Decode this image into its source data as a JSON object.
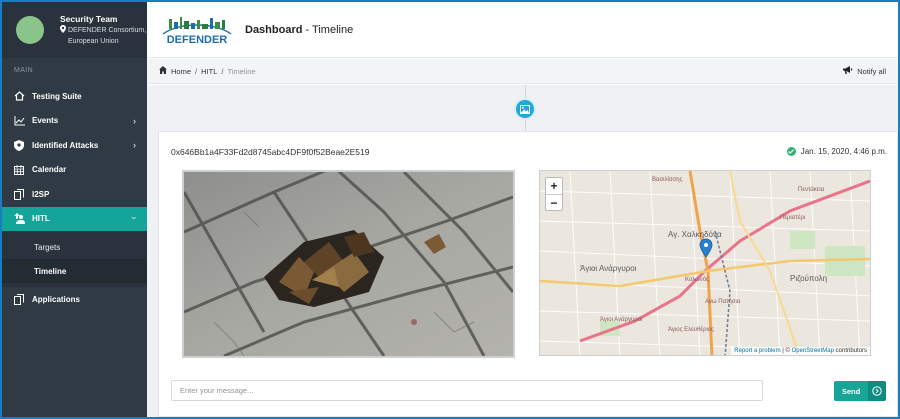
{
  "profile": {
    "name": "Security Team",
    "org_line1": "DEFENDER Consortium,",
    "org_line2": "European Union"
  },
  "sidebar": {
    "section_label": "MAIN",
    "items": [
      {
        "label": "Testing Suite",
        "icon": "home-outline-icon"
      },
      {
        "label": "Events",
        "icon": "chart-line-icon"
      },
      {
        "label": "Identified Attacks",
        "icon": "shield-icon"
      },
      {
        "label": "Calendar",
        "icon": "calendar-icon"
      },
      {
        "label": "I2SP",
        "icon": "copy-icon"
      },
      {
        "label": "HITL",
        "icon": "user-upload-icon"
      },
      {
        "label": "Applications",
        "icon": "copy-icon"
      }
    ],
    "hitl_subitems": [
      {
        "label": "Targets"
      },
      {
        "label": "Timeline"
      }
    ],
    "colors": {
      "background": "#2f3a45",
      "active": "#13a59a"
    }
  },
  "header": {
    "logo_text": "DEFENDER",
    "title_bold": "Dashboard",
    "title_rest": " - Timeline"
  },
  "breadcrumb": {
    "home": "Home",
    "hitl": "HITL",
    "current": "Timeline",
    "separator": "/"
  },
  "notify": {
    "label": "Notify all"
  },
  "card": {
    "id": "0x646Bb1a4F33Fd2d8745abc4DF9f0f52Beae2E519",
    "date": "Jan. 15, 2020, 4:46 p.m.",
    "zoom_in": "+",
    "zoom_out": "−",
    "attribution_report": "Report a problem",
    "attribution_sep": " | © ",
    "attribution_osm": "OpenStreetMap",
    "attribution_tail": " contributors",
    "message_placeholder": "Enter your message...",
    "send_label": "Send"
  },
  "map_labels": {
    "l1": "Βασιλίσσης",
    "l2": "Πεντάκεια",
    "l3": "Περιστέρι",
    "l4": "Αγ. Χαλκηδόνα",
    "l5": "Άγιοι Ανάργυροι",
    "l6": "Ριζούπολη",
    "l7": "Άγιοι Ανάργυροι",
    "l8": "Άγιος Ελευθέριος",
    "l9": "Κολωνός",
    "l10": "Ανω Πατήσια"
  }
}
